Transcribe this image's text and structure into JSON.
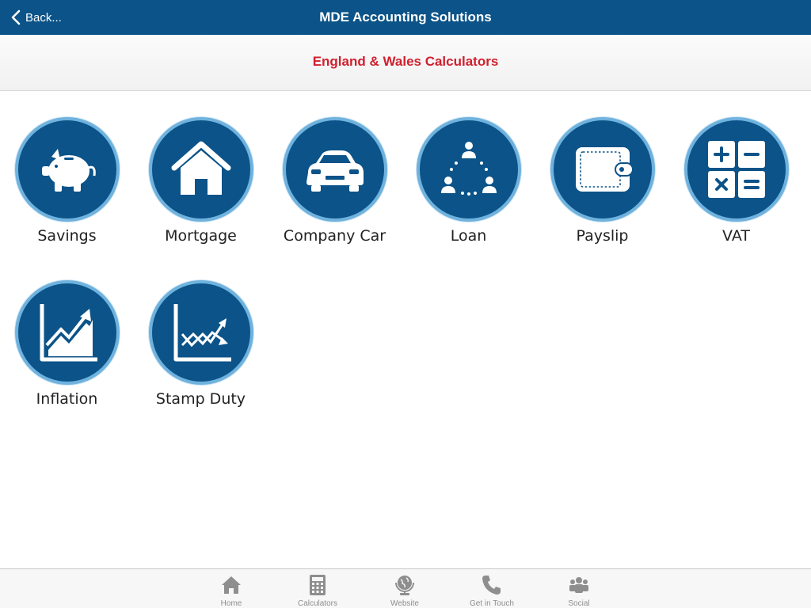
{
  "navbar": {
    "back_label": "Back...",
    "title": "MDE Accounting Solutions"
  },
  "subheader": {
    "title": "England & Wales Calculators"
  },
  "calculators": [
    {
      "label": "Savings",
      "icon": "piggy-bank-icon"
    },
    {
      "label": "Mortgage",
      "icon": "house-icon"
    },
    {
      "label": "Company Car",
      "icon": "car-icon"
    },
    {
      "label": "Loan",
      "icon": "people-network-icon"
    },
    {
      "label": "Payslip",
      "icon": "wallet-icon"
    },
    {
      "label": "VAT",
      "icon": "calculator-icon"
    },
    {
      "label": "Inflation",
      "icon": "rising-chart-icon"
    },
    {
      "label": "Stamp Duty",
      "icon": "crossing-trend-chart-icon"
    }
  ],
  "tabbar": [
    {
      "label": "Home",
      "icon": "home-icon"
    },
    {
      "label": "Calculators",
      "icon": "calculator-icon"
    },
    {
      "label": "Website",
      "icon": "globe-icon"
    },
    {
      "label": "Get in Touch",
      "icon": "phone-icon"
    },
    {
      "label": "Social",
      "icon": "group-icon"
    }
  ],
  "colors": {
    "brand_blue": "#0b5388",
    "ring_blue": "#6fb2de",
    "subheader_red": "#d0202e",
    "tab_grey": "#8e8e8e"
  }
}
